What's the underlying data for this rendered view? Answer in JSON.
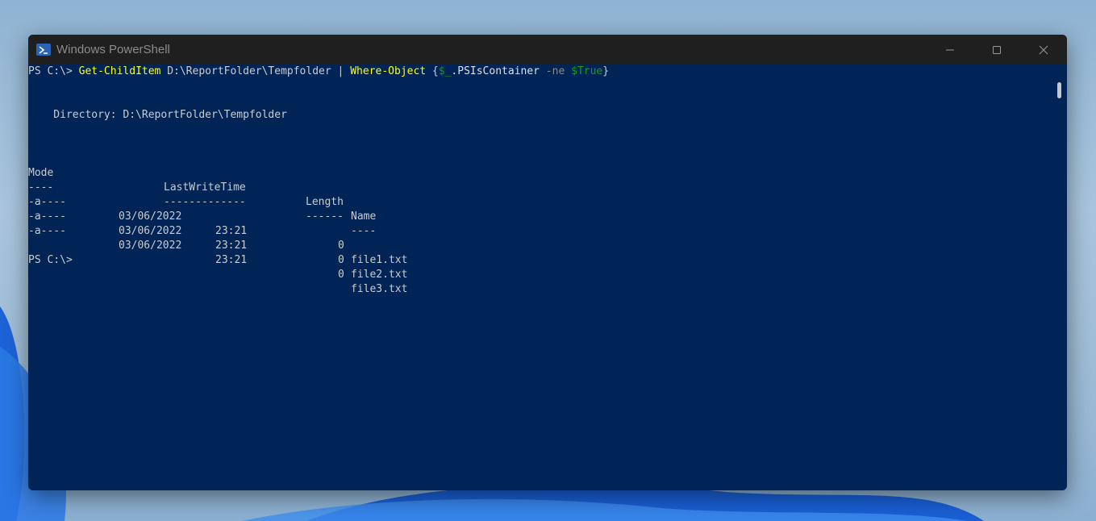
{
  "window": {
    "title": "Windows PowerShell",
    "icon": "powershell-icon",
    "controls": [
      "minimize-icon",
      "maximize-icon",
      "close-icon"
    ]
  },
  "terminal": {
    "command_line": {
      "prompt": "PS C:\\> ",
      "cmdlet": "Get-ChildItem",
      "arg_path": " D:\\ReportFolder\\Tempfolder | ",
      "cmdlet2": "Where-Object",
      "brace_open": " {",
      "variable": "$_",
      "property": ".PSIsContainer ",
      "operator": "-ne",
      "space": " ",
      "value": "$True",
      "brace_close": "}"
    },
    "directory_line": "    Directory: D:\\ReportFolder\\Tempfolder",
    "headers": {
      "mode": "Mode",
      "lastwritetime": "LastWriteTime",
      "length": "Length",
      "name": "Name"
    },
    "underlines": {
      "mode": "----",
      "lastwritetime": "-------------",
      "length": "------",
      "name": "----"
    },
    "rows": [
      {
        "mode": "-a----",
        "date": "03/06/2022",
        "time": "23:21",
        "length": "0",
        "name": "file1.txt"
      },
      {
        "mode": "-a----",
        "date": "03/06/2022",
        "time": "23:21",
        "length": "0",
        "name": "file2.txt"
      },
      {
        "mode": "-a----",
        "date": "03/06/2022",
        "time": "23:21",
        "length": "0",
        "name": "file3.txt"
      }
    ],
    "final_prompt": "PS C:\\>"
  },
  "colors": {
    "console_background": "#012456",
    "console_text": "#cccccc",
    "cmdlet": "#ffff00",
    "parameter": "#8a8a8a",
    "variable": "#13a10e",
    "titlebar": "#1f1f1f"
  }
}
